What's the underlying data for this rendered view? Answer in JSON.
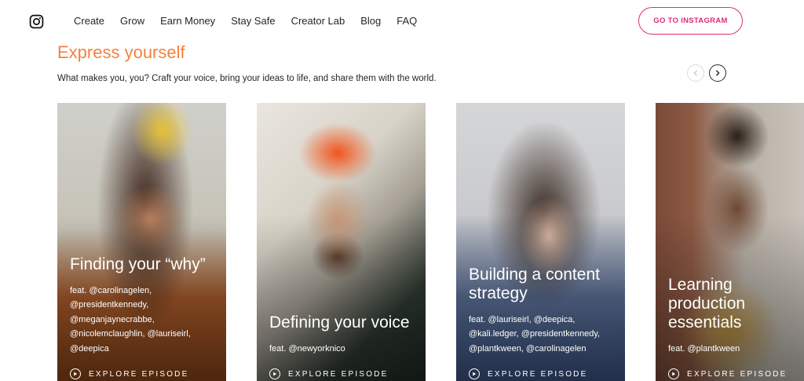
{
  "nav": {
    "items": [
      "Create",
      "Grow",
      "Earn Money",
      "Stay Safe",
      "Creator Lab",
      "Blog",
      "FAQ"
    ],
    "cta_label": "GO TO INSTAGRAM"
  },
  "section": {
    "title": "Express yourself",
    "subtitle": "What makes you, you? Craft your voice, bring your ideas to life, and share them with the world."
  },
  "cards": [
    {
      "title_lines": [
        "Finding your “why”"
      ],
      "feat_lines": [
        "feat. @carolinagelen,",
        "@presidentkennedy,",
        "@meganjaynecrabbe,",
        "@nicolemclaughlin, @lauriseirl,",
        "@deepica"
      ],
      "cta": "EXPLORE EPISODE"
    },
    {
      "title_lines": [
        "Defining your voice"
      ],
      "feat_lines": [
        "feat. @newyorknico"
      ],
      "cta": "EXPLORE EPISODE"
    },
    {
      "title_lines": [
        "Building a content",
        "strategy"
      ],
      "feat_lines": [
        "feat. @lauriseirl, @deepica,",
        "@kali.ledger, @presidentkennedy,",
        "@plantkween, @carolinagelen"
      ],
      "cta": "EXPLORE EPISODE"
    },
    {
      "title_lines": [
        "Learning",
        "production",
        "essentials"
      ],
      "feat_lines": [
        "feat. @plantkween"
      ],
      "cta": "EXPLORE EPISODE"
    }
  ],
  "colors": {
    "accent_orange": "#f5803e",
    "cta_pink": "#dd2a7b",
    "text": "#262626"
  },
  "icons": {
    "logo": "instagram-icon",
    "prev": "chevron-left-icon",
    "next": "chevron-right-icon",
    "play": "play-icon"
  }
}
